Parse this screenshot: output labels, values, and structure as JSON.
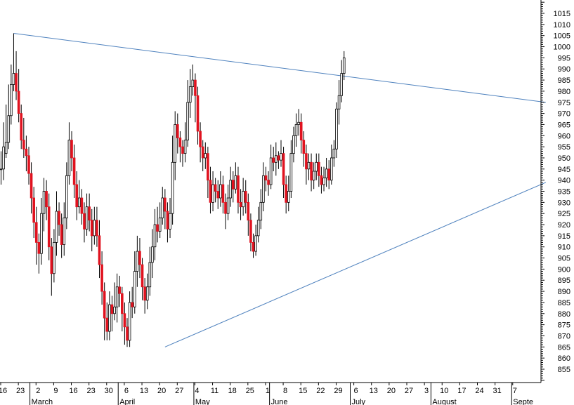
{
  "chart_data": {
    "type": "candlestick",
    "title": "",
    "xlabel": "",
    "ylabel": "",
    "ylim": [
      849,
      1021
    ],
    "y_ticks": [
      855,
      860,
      865,
      870,
      875,
      880,
      885,
      890,
      895,
      900,
      905,
      910,
      915,
      920,
      925,
      930,
      935,
      940,
      945,
      950,
      955,
      960,
      965,
      970,
      975,
      980,
      985,
      990,
      995,
      1000,
      1005,
      1010,
      1015
    ],
    "x_tick_labels": [
      "16",
      "23",
      "2",
      "9",
      "16",
      "23",
      "30",
      "6",
      "13",
      "20",
      "27",
      "4",
      "11",
      "18",
      "25",
      "1",
      "8",
      "15",
      "22",
      "29",
      "6",
      "13",
      "20",
      "27",
      "3",
      "10",
      "17",
      "24",
      "31",
      "7"
    ],
    "months": [
      {
        "label": "March",
        "start_index": 12
      },
      {
        "label": "April",
        "start_index": 47
      },
      {
        "label": "May",
        "start_index": 77
      },
      {
        "label": "June",
        "start_index": 107
      },
      {
        "label": "July",
        "start_index": 139
      },
      {
        "label": "August",
        "start_index": 171
      },
      {
        "label": "Septe",
        "start_index": 203
      }
    ],
    "colors": {
      "up": "#ffffff",
      "down": "#e0121f",
      "outline": "#000000",
      "trendline": "#4f82be",
      "grid": "#000000"
    },
    "trendlines": [
      {
        "name": "resistance",
        "from": {
          "index": 5,
          "value": 1006
        },
        "to": {
          "index": 216,
          "value": 975
        }
      },
      {
        "name": "support",
        "from": {
          "index": 65,
          "value": 865
        },
        "to": {
          "index": 216,
          "value": 939
        }
      }
    ],
    "candles": [
      [
        0,
        945,
        945,
        953,
        938
      ],
      [
        1,
        945,
        955,
        966,
        940
      ],
      [
        2,
        952,
        957,
        974,
        950
      ],
      [
        3,
        957,
        969,
        983,
        954
      ],
      [
        4,
        969,
        983,
        992,
        965
      ],
      [
        5,
        983,
        988,
        1006,
        980
      ],
      [
        6,
        988,
        980,
        998,
        976
      ],
      [
        7,
        980,
        970,
        990,
        966
      ],
      [
        8,
        970,
        958,
        974,
        954
      ],
      [
        9,
        958,
        954,
        968,
        950
      ],
      [
        10,
        954,
        951,
        960,
        944
      ],
      [
        11,
        951,
        943,
        955,
        938
      ],
      [
        12,
        943,
        932,
        948,
        925
      ],
      [
        13,
        932,
        921,
        937,
        914
      ],
      [
        14,
        921,
        912,
        928,
        902
      ],
      [
        15,
        912,
        907,
        916,
        898
      ],
      [
        16,
        907,
        925,
        932,
        902
      ],
      [
        17,
        925,
        935,
        941,
        917
      ],
      [
        18,
        935,
        928,
        940,
        922
      ],
      [
        19,
        928,
        910,
        934,
        904
      ],
      [
        20,
        910,
        898,
        914,
        888
      ],
      [
        21,
        898,
        912,
        918,
        894
      ],
      [
        22,
        912,
        926,
        935,
        906
      ],
      [
        23,
        926,
        920,
        930,
        915
      ],
      [
        24,
        920,
        911,
        925,
        905
      ],
      [
        25,
        911,
        923,
        930,
        906
      ],
      [
        26,
        923,
        942,
        948,
        918
      ],
      [
        27,
        942,
        958,
        966,
        938
      ],
      [
        28,
        958,
        950,
        962,
        944
      ],
      [
        29,
        950,
        938,
        956,
        932
      ],
      [
        30,
        938,
        928,
        944,
        922
      ],
      [
        31,
        928,
        932,
        940,
        925
      ],
      [
        32,
        932,
        925,
        936,
        920
      ],
      [
        33,
        925,
        918,
        930,
        912
      ],
      [
        34,
        918,
        928,
        934,
        915
      ],
      [
        35,
        928,
        922,
        934,
        917
      ],
      [
        36,
        922,
        915,
        927,
        908
      ],
      [
        37,
        915,
        922,
        928,
        911
      ],
      [
        38,
        922,
        915,
        928,
        910
      ],
      [
        39,
        915,
        902,
        922,
        896
      ],
      [
        40,
        902,
        890,
        908,
        884
      ],
      [
        41,
        890,
        878,
        894,
        868
      ],
      [
        42,
        878,
        872,
        885,
        868
      ],
      [
        43,
        872,
        884,
        890,
        868
      ],
      [
        44,
        884,
        880,
        888,
        872
      ],
      [
        45,
        880,
        883,
        894,
        877
      ],
      [
        46,
        883,
        892,
        898,
        876
      ],
      [
        47,
        892,
        889,
        897,
        883
      ],
      [
        48,
        889,
        880,
        892,
        872
      ],
      [
        49,
        880,
        874,
        885,
        866
      ],
      [
        50,
        874,
        868,
        878,
        865
      ],
      [
        51,
        868,
        885,
        890,
        865
      ],
      [
        52,
        885,
        883,
        892,
        878
      ],
      [
        53,
        883,
        899,
        908,
        880
      ],
      [
        54,
        899,
        908,
        915,
        892
      ],
      [
        55,
        908,
        902,
        914,
        896
      ],
      [
        56,
        902,
        892,
        905,
        886
      ],
      [
        57,
        892,
        886,
        896,
        880
      ],
      [
        58,
        886,
        892,
        898,
        882
      ],
      [
        59,
        892,
        903,
        910,
        888
      ],
      [
        60,
        903,
        910,
        918,
        896
      ],
      [
        61,
        910,
        920,
        927,
        904
      ],
      [
        62,
        920,
        917,
        928,
        912
      ],
      [
        63,
        917,
        923,
        930,
        914
      ],
      [
        64,
        923,
        932,
        937,
        920
      ],
      [
        65,
        932,
        926,
        936,
        918
      ],
      [
        66,
        926,
        918,
        930,
        912
      ],
      [
        67,
        918,
        925,
        932,
        914
      ],
      [
        68,
        925,
        948,
        960,
        920
      ],
      [
        69,
        948,
        965,
        971,
        940
      ],
      [
        70,
        965,
        959,
        970,
        952
      ],
      [
        71,
        959,
        955,
        962,
        948
      ],
      [
        72,
        955,
        952,
        958,
        946
      ],
      [
        73,
        952,
        958,
        966,
        948
      ],
      [
        74,
        958,
        975,
        985,
        955
      ],
      [
        75,
        975,
        982,
        990,
        968
      ],
      [
        76,
        982,
        985,
        992,
        978
      ],
      [
        77,
        985,
        978,
        988,
        966
      ],
      [
        78,
        978,
        962,
        982,
        956
      ],
      [
        79,
        962,
        955,
        966,
        948
      ],
      [
        80,
        955,
        950,
        958,
        944
      ],
      [
        81,
        950,
        952,
        957,
        945
      ],
      [
        82,
        952,
        940,
        955,
        932
      ],
      [
        83,
        940,
        930,
        946,
        925
      ],
      [
        84,
        930,
        938,
        944,
        926
      ],
      [
        85,
        938,
        935,
        941,
        930
      ],
      [
        86,
        935,
        932,
        940,
        927
      ],
      [
        87,
        932,
        938,
        944,
        928
      ],
      [
        88,
        938,
        930,
        942,
        925
      ],
      [
        89,
        930,
        925,
        934,
        918
      ],
      [
        90,
        925,
        932,
        938,
        922
      ],
      [
        91,
        932,
        940,
        946,
        928
      ],
      [
        92,
        940,
        936,
        944,
        930
      ],
      [
        93,
        936,
        942,
        948,
        934
      ],
      [
        94,
        942,
        930,
        946,
        925
      ],
      [
        95,
        930,
        928,
        936,
        922
      ],
      [
        96,
        928,
        935,
        941,
        924
      ],
      [
        97,
        935,
        930,
        940,
        925
      ],
      [
        98,
        930,
        922,
        934,
        915
      ],
      [
        99,
        922,
        912,
        925,
        908
      ],
      [
        100,
        912,
        908,
        916,
        905
      ],
      [
        101,
        908,
        915,
        920,
        906
      ],
      [
        102,
        915,
        922,
        928,
        912
      ],
      [
        103,
        922,
        930,
        936,
        918
      ],
      [
        104,
        930,
        942,
        948,
        926
      ],
      [
        105,
        942,
        940,
        946,
        935
      ],
      [
        106,
        940,
        938,
        944,
        933
      ],
      [
        107,
        938,
        950,
        956,
        936
      ],
      [
        108,
        950,
        948,
        955,
        944
      ],
      [
        109,
        948,
        951,
        957,
        942
      ],
      [
        110,
        951,
        949,
        953,
        945
      ],
      [
        111,
        949,
        952,
        958,
        946
      ],
      [
        112,
        952,
        938,
        955,
        932
      ],
      [
        113,
        938,
        930,
        942,
        925
      ],
      [
        114,
        930,
        935,
        942,
        926
      ],
      [
        115,
        935,
        952,
        958,
        932
      ],
      [
        116,
        952,
        960,
        964,
        948
      ],
      [
        117,
        960,
        965,
        970,
        955
      ],
      [
        118,
        965,
        966,
        972,
        960
      ],
      [
        119,
        966,
        958,
        970,
        952
      ],
      [
        120,
        958,
        952,
        962,
        946
      ],
      [
        121,
        952,
        945,
        956,
        938
      ],
      [
        122,
        945,
        948,
        952,
        940
      ],
      [
        123,
        948,
        940,
        952,
        935
      ],
      [
        124,
        940,
        944,
        948,
        936
      ],
      [
        125,
        944,
        948,
        952,
        940
      ],
      [
        126,
        948,
        942,
        952,
        937
      ],
      [
        127,
        942,
        938,
        946,
        934
      ],
      [
        128,
        938,
        941,
        946,
        935
      ],
      [
        129,
        941,
        945,
        950,
        937
      ],
      [
        130,
        945,
        940,
        949,
        936
      ],
      [
        131,
        940,
        950,
        956,
        938
      ],
      [
        132,
        950,
        954,
        958,
        946
      ],
      [
        133,
        954,
        972,
        975,
        950
      ],
      [
        134,
        972,
        978,
        985,
        965
      ],
      [
        135,
        978,
        988,
        994,
        975
      ],
      [
        136,
        988,
        995,
        998,
        985
      ]
    ]
  }
}
